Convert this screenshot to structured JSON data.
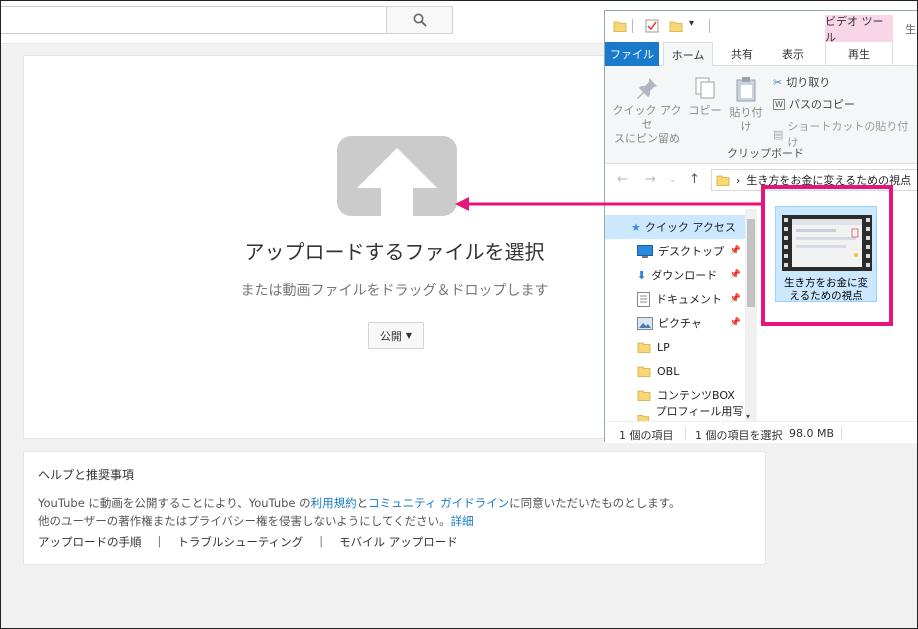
{
  "youtube": {
    "search_icon": "search-icon",
    "upload": {
      "title": "アップロードするファイルを選択",
      "subtitle": "または動画ファイルをドラッグ＆ドロップします",
      "privacy_label": "公開"
    },
    "help": {
      "title": "ヘルプと推奨事項",
      "text_pre": "YouTube に動画を公開することにより、YouTube の",
      "terms_link": "利用規約",
      "and": "と",
      "guidelines_link": "コミュニティ ガイドライン",
      "text_post": "に同意いただいたものとします。",
      "line2": "他のユーザーの著作権またはプライバシー権を侵害しないようにしてください。",
      "details_link": "詳細",
      "links": [
        "アップロードの手順",
        "トラブルシューティング",
        "モバイル アップロード"
      ]
    }
  },
  "explorer": {
    "context_tab": "ビデオ ツール",
    "title_tail": "生",
    "tabs": {
      "file": "ファイル",
      "home": "ホーム",
      "share": "共有",
      "view": "表示",
      "play": "再生"
    },
    "ribbon": {
      "pin_line1": "クイック アクセ",
      "pin_line2": "スにピン留め",
      "copy": "コピー",
      "paste": "貼り付け",
      "cut": "切り取り",
      "copy_path": "パスのコピー",
      "paste_shortcut": "ショートカットの貼り付け",
      "group_label": "クリップボード"
    },
    "address": "生き方をお金に変えるための視点",
    "address_sep": "›",
    "nav": [
      {
        "label": "クイック アクセス"
      },
      {
        "label": "デスクトップ"
      },
      {
        "label": "ダウンロード"
      },
      {
        "label": "ドキュメント"
      },
      {
        "label": "ピクチャ"
      },
      {
        "label": "LP"
      },
      {
        "label": "OBL"
      },
      {
        "label": "コンテンツBOX"
      },
      {
        "label": "プロフィール用写真"
      }
    ],
    "file": {
      "name_line1": "生き方をお金に変",
      "name_line2": "えるための視点"
    },
    "status": {
      "count": "1 個の項目",
      "selected": "1 個の項目を選択",
      "size": "98.0 MB"
    }
  },
  "colors": {
    "highlight": "#e5157c",
    "file_tab": "#1979ca",
    "context_tab_bg": "#f9d5e8",
    "selection": "#cce8ff",
    "link": "#167ac6"
  }
}
